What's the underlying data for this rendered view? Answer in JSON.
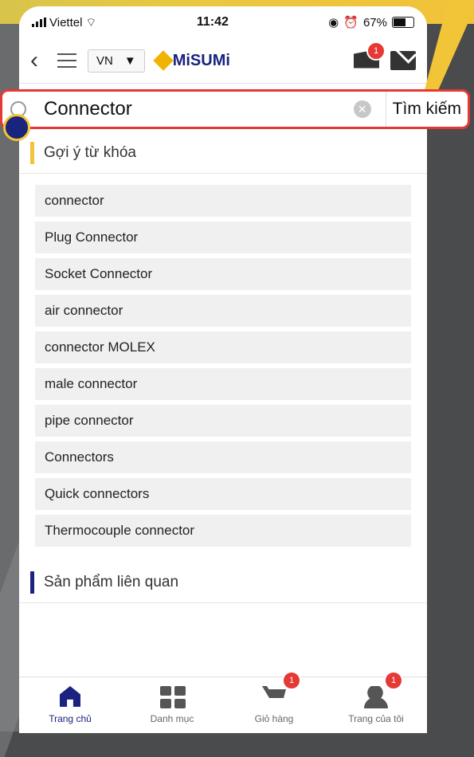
{
  "status": {
    "carrier": "Viettel",
    "time": "11:42",
    "battery": "67%"
  },
  "header": {
    "language": "VN",
    "brand": "MiSUMi",
    "cart_badge": "1"
  },
  "search": {
    "value": "Connector",
    "button_label": "Tìm kiếm"
  },
  "suggestions": {
    "title": "Gợi ý từ khóa",
    "items": [
      "connector",
      "Plug Connector",
      "Socket Connector",
      "air connector",
      "connector MOLEX",
      "male connector",
      "pipe connector",
      "Connectors",
      "Quick connectors",
      "Thermocouple connector"
    ],
    "accent": "#f2c437"
  },
  "related": {
    "title": "Sản phẩm liên quan",
    "accent": "#1a237e"
  },
  "tabs": [
    {
      "label": "Trang chủ",
      "icon": "home-icon"
    },
    {
      "label": "Danh mục",
      "icon": "grid-icon"
    },
    {
      "label": "Giỏ hàng",
      "icon": "cart-icon",
      "badge": "1"
    },
    {
      "label": "Trang của tôi",
      "icon": "user-icon",
      "badge": "1"
    }
  ]
}
